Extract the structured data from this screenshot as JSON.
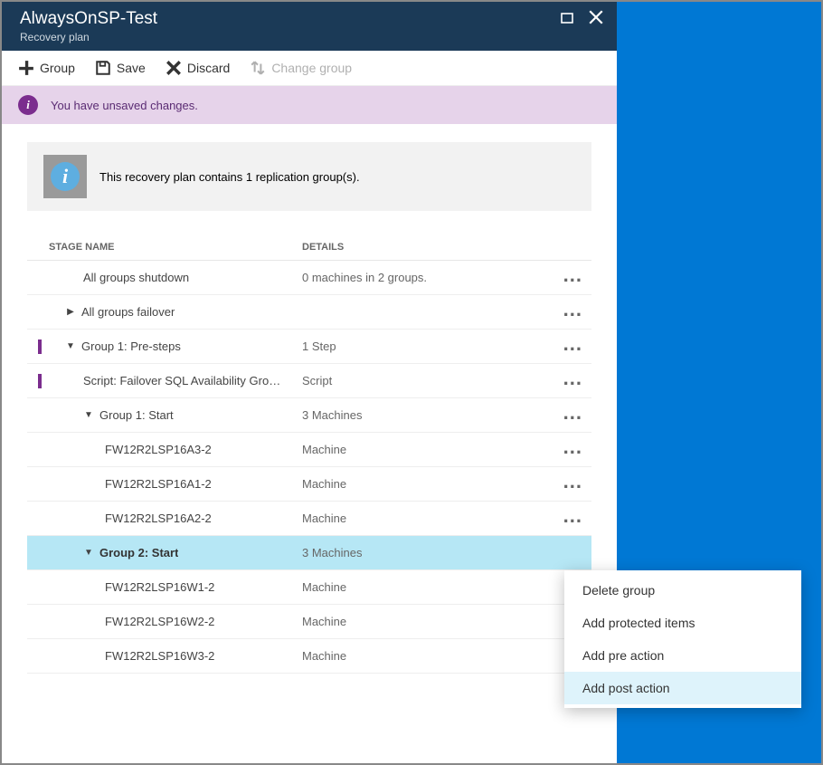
{
  "header": {
    "title": "AlwaysOnSP-Test",
    "subtitle": "Recovery plan"
  },
  "toolbar": {
    "group": "Group",
    "save": "Save",
    "discard": "Discard",
    "change_group": "Change group"
  },
  "banner": {
    "text": "You have unsaved changes."
  },
  "infobox": {
    "text": "This recovery plan contains 1 replication group(s)."
  },
  "columns": {
    "name": "STAGE NAME",
    "details": "DETAILS"
  },
  "rows": [
    {
      "name": "All groups shutdown",
      "details": "0 machines in 2 groups.",
      "indent": 1,
      "arrow": "",
      "marker": false,
      "ellipsis": true,
      "selected": false
    },
    {
      "name": "All groups failover",
      "details": "",
      "indent": 0,
      "arrow": "right",
      "marker": false,
      "ellipsis": true,
      "selected": false
    },
    {
      "name": "Group 1: Pre-steps",
      "details": "1 Step",
      "indent": 0,
      "arrow": "down",
      "marker": true,
      "ellipsis": true,
      "selected": false
    },
    {
      "name": "Script: Failover SQL Availability Gro…",
      "details": "Script",
      "indent": 1,
      "arrow": "",
      "marker": true,
      "ellipsis": true,
      "selected": false
    },
    {
      "name": "Group 1: Start",
      "details": "3 Machines",
      "indent": 1,
      "arrow": "down",
      "marker": false,
      "ellipsis": true,
      "selected": false
    },
    {
      "name": "FW12R2LSP16A3-2",
      "details": "Machine",
      "indent": 2,
      "arrow": "",
      "marker": false,
      "ellipsis": true,
      "selected": false
    },
    {
      "name": "FW12R2LSP16A1-2",
      "details": "Machine",
      "indent": 2,
      "arrow": "",
      "marker": false,
      "ellipsis": true,
      "selected": false
    },
    {
      "name": "FW12R2LSP16A2-2",
      "details": "Machine",
      "indent": 2,
      "arrow": "",
      "marker": false,
      "ellipsis": true,
      "selected": false
    },
    {
      "name": "Group 2: Start",
      "details": "3 Machines",
      "indent": 1,
      "arrow": "down",
      "marker": false,
      "ellipsis": false,
      "selected": true
    },
    {
      "name": "FW12R2LSP16W1-2",
      "details": "Machine",
      "indent": 2,
      "arrow": "",
      "marker": false,
      "ellipsis": true,
      "selected": false
    },
    {
      "name": "FW12R2LSP16W2-2",
      "details": "Machine",
      "indent": 2,
      "arrow": "",
      "marker": false,
      "ellipsis": true,
      "selected": false
    },
    {
      "name": "FW12R2LSP16W3-2",
      "details": "Machine",
      "indent": 2,
      "arrow": "",
      "marker": false,
      "ellipsis": true,
      "selected": false
    }
  ],
  "context_menu": {
    "items": [
      {
        "label": "Delete group",
        "hover": false
      },
      {
        "label": "Add protected items",
        "hover": false
      },
      {
        "label": "Add pre action",
        "hover": false
      },
      {
        "label": "Add post action",
        "hover": true
      }
    ]
  }
}
